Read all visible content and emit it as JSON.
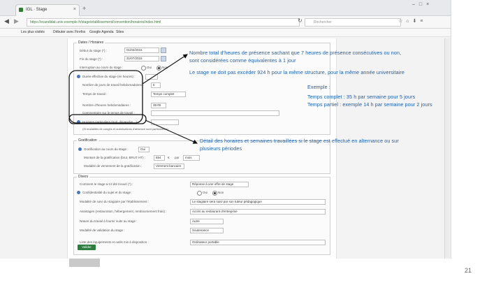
{
  "browser": {
    "tab_title": "IGL · Stage",
    "url": "https://ecandidat.univ-exemple.fr/stage/etablissement/convention/horaires/index.html",
    "search_placeholder": "Rechercher",
    "bookmarks": [
      "Les plus visités",
      "Débuter avec Firefox",
      "Google Agenda",
      "Sites"
    ]
  },
  "form": {
    "section_period": {
      "legend": "Dates / Horaires",
      "fields": [
        {
          "label": "Début du stage (*) :",
          "value": "01/02/2015"
        },
        {
          "label": "Fin du stage (*) :",
          "value": "31/07/2015"
        },
        {
          "label": "Interruption au cours du stage :"
        }
      ],
      "interruption_options": [
        "Oui",
        "Non"
      ],
      "duration_label": "Durée effective du stage (en heures) :",
      "duration_value": "",
      "days_label": "Nombre de jours de travail hebdomadaires :",
      "days_value": "5",
      "time_label": "Temps de travail :",
      "time_value": "Temps complet",
      "hours_label": "Nombre d'heures hebdomadaires :",
      "hours_value": "35:00",
      "comment_label": "Commentaire sur le temps de travail :",
      "comment_value": "",
      "schedule_label": "Horaires particuliers (nuit, dimanche…) :",
      "schedule_hint": "(Si modalités de congés et autorisations d'absence sont particulières)"
    },
    "section_gratification": {
      "legend": "Gratification",
      "question": "Gratification au cours du stage :",
      "question_value": "Oui",
      "amount_label": "Montant de la gratification (brut, BRUT HT) :",
      "amount_value": "554",
      "amount_unit": "€",
      "per_label": "par",
      "per_value": "mois",
      "payment_label": "Modalité de versement de la gratification :",
      "payment_value": "Virement bancaire"
    },
    "section_other": {
      "legend": "Divers",
      "fields": [
        {
          "label": "Comment le stage a-t-il été trouvé (*) :",
          "value": "Réponse à une offre de stage"
        },
        {
          "label": "Confidentialité du sujet et du stage :"
        },
        {
          "label": "Modalité de suivi du stagiaire par l'établissement :",
          "value": "Le stagiaire sera suivi par son tuteur pédagogique"
        },
        {
          "label": "Avantages (restauration, hébergement, remboursement frais) :",
          "value": "Accès au restaurant d'entreprise"
        },
        {
          "label": "Nature du travail à fournir suite au stage :",
          "value": "Autre"
        },
        {
          "label": "Modalité de validation du stage :",
          "value": "Soutenance"
        },
        {
          "label": "Liste des équipements et outils mis à disposition :",
          "value": "Ordinateur portable"
        }
      ],
      "confidential_options": [
        "Oui",
        "Non"
      ]
    },
    "submit_label": "Valider"
  },
  "annotations": {
    "a1_line1": "Nombre total d’heures de présence sachant que 7 heures de présence consécutives ou non,",
    "a1_line2": "sont considérées comme équivalentes à 1 jour",
    "a2": "Le stage ne doit pas excéder 924 h pour la même structure, pour la même année universitaire",
    "a3_title": "Exemple :",
    "a3_line1": "Temps complet : 35 h par semaine pour 5 jours",
    "a3_line2": "Temps partiel : exemple 14 h par semaine pour 2 jours",
    "a4_line1": "Détail des horaires et semaines travaillées si le stage est effectué en alternance ou sur",
    "a4_line2": "plusieurs périodes"
  },
  "slide": {
    "page_number": "21"
  },
  "colors": {
    "annotation_text": "#1b5fa8",
    "submit": "#2d7d3e"
  }
}
